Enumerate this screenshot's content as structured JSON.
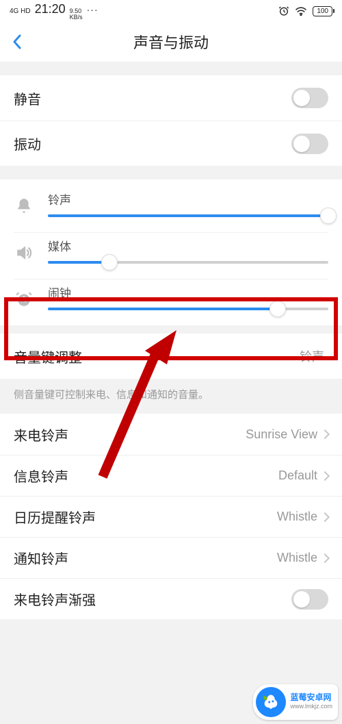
{
  "status": {
    "network_type": "4G HD",
    "time": "21:20",
    "kbs_top": "9.50",
    "kbs_bottom": "KB/s",
    "dots": "···",
    "battery": "100"
  },
  "nav": {
    "title": "声音与振动"
  },
  "toggles": {
    "silent_label": "静音",
    "vibrate_label": "振动"
  },
  "sliders": {
    "ring": {
      "label": "铃声",
      "value_pct": 100
    },
    "media": {
      "label": "媒体",
      "value_pct": 22
    },
    "alarm": {
      "label": "闹钟",
      "value_pct": 82
    }
  },
  "volume_key": {
    "label": "音量键调整",
    "value": "铃声",
    "helper": "侧音量键可控制来电、信息和通知的音量。"
  },
  "ringtones": {
    "incoming": {
      "label": "来电铃声",
      "value": "Sunrise View"
    },
    "message": {
      "label": "信息铃声",
      "value": "Default"
    },
    "calendar": {
      "label": "日历提醒铃声",
      "value": "Whistle"
    },
    "notify": {
      "label": "通知铃声",
      "value": "Whistle"
    }
  },
  "ascending": {
    "label": "来电铃声渐强"
  },
  "watermark": {
    "title": "蓝莓安卓网",
    "url": "www.lmkjz.com"
  }
}
